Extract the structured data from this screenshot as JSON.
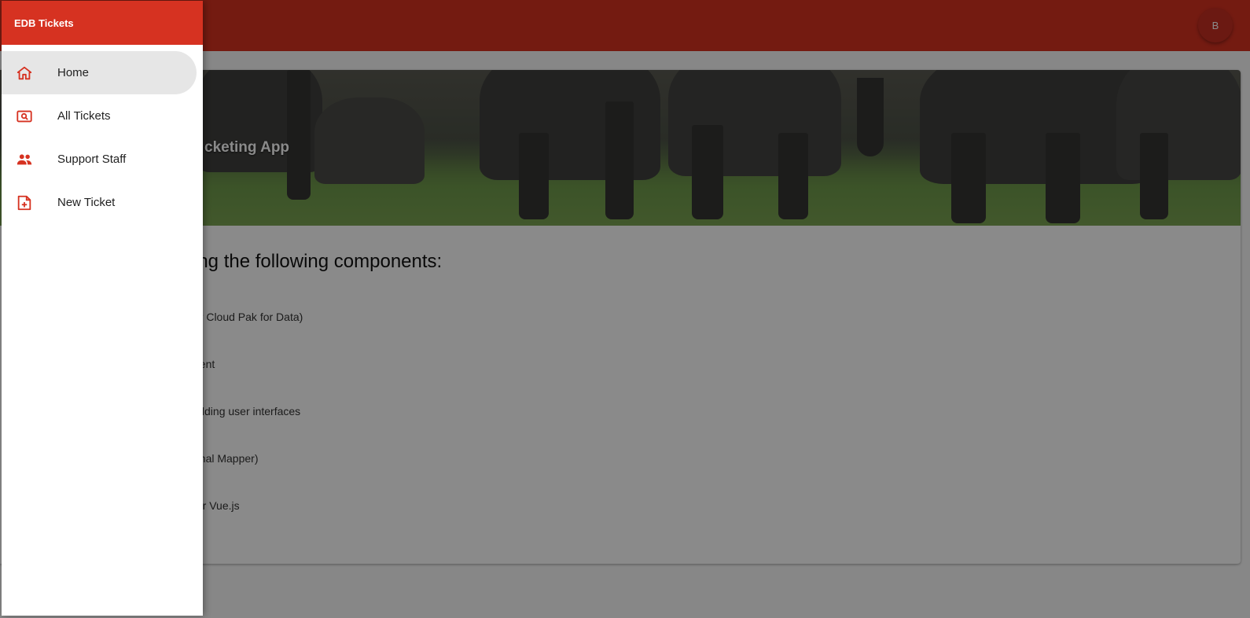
{
  "app_bar": {
    "avatar_initial": "B"
  },
  "drawer": {
    "title": "EDB Tickets",
    "items": [
      {
        "label": "Home",
        "icon": "home-icon",
        "active": true
      },
      {
        "label": "All Tickets",
        "icon": "ticket-search-icon",
        "active": false
      },
      {
        "label": "Support Staff",
        "icon": "people-icon",
        "active": false
      },
      {
        "label": "New Ticket",
        "icon": "new-document-icon",
        "active": false
      }
    ]
  },
  "main": {
    "hero_title": "cketing App",
    "headline": "ing the following components:",
    "components": [
      "or Cloud Pak for Data)",
      "nent",
      "uilding user interfaces",
      "onal Mapper)",
      "for Vue.js"
    ]
  },
  "colors": {
    "accent": "#d63221",
    "scrim": "rgba(0,0,0,0.46)"
  }
}
